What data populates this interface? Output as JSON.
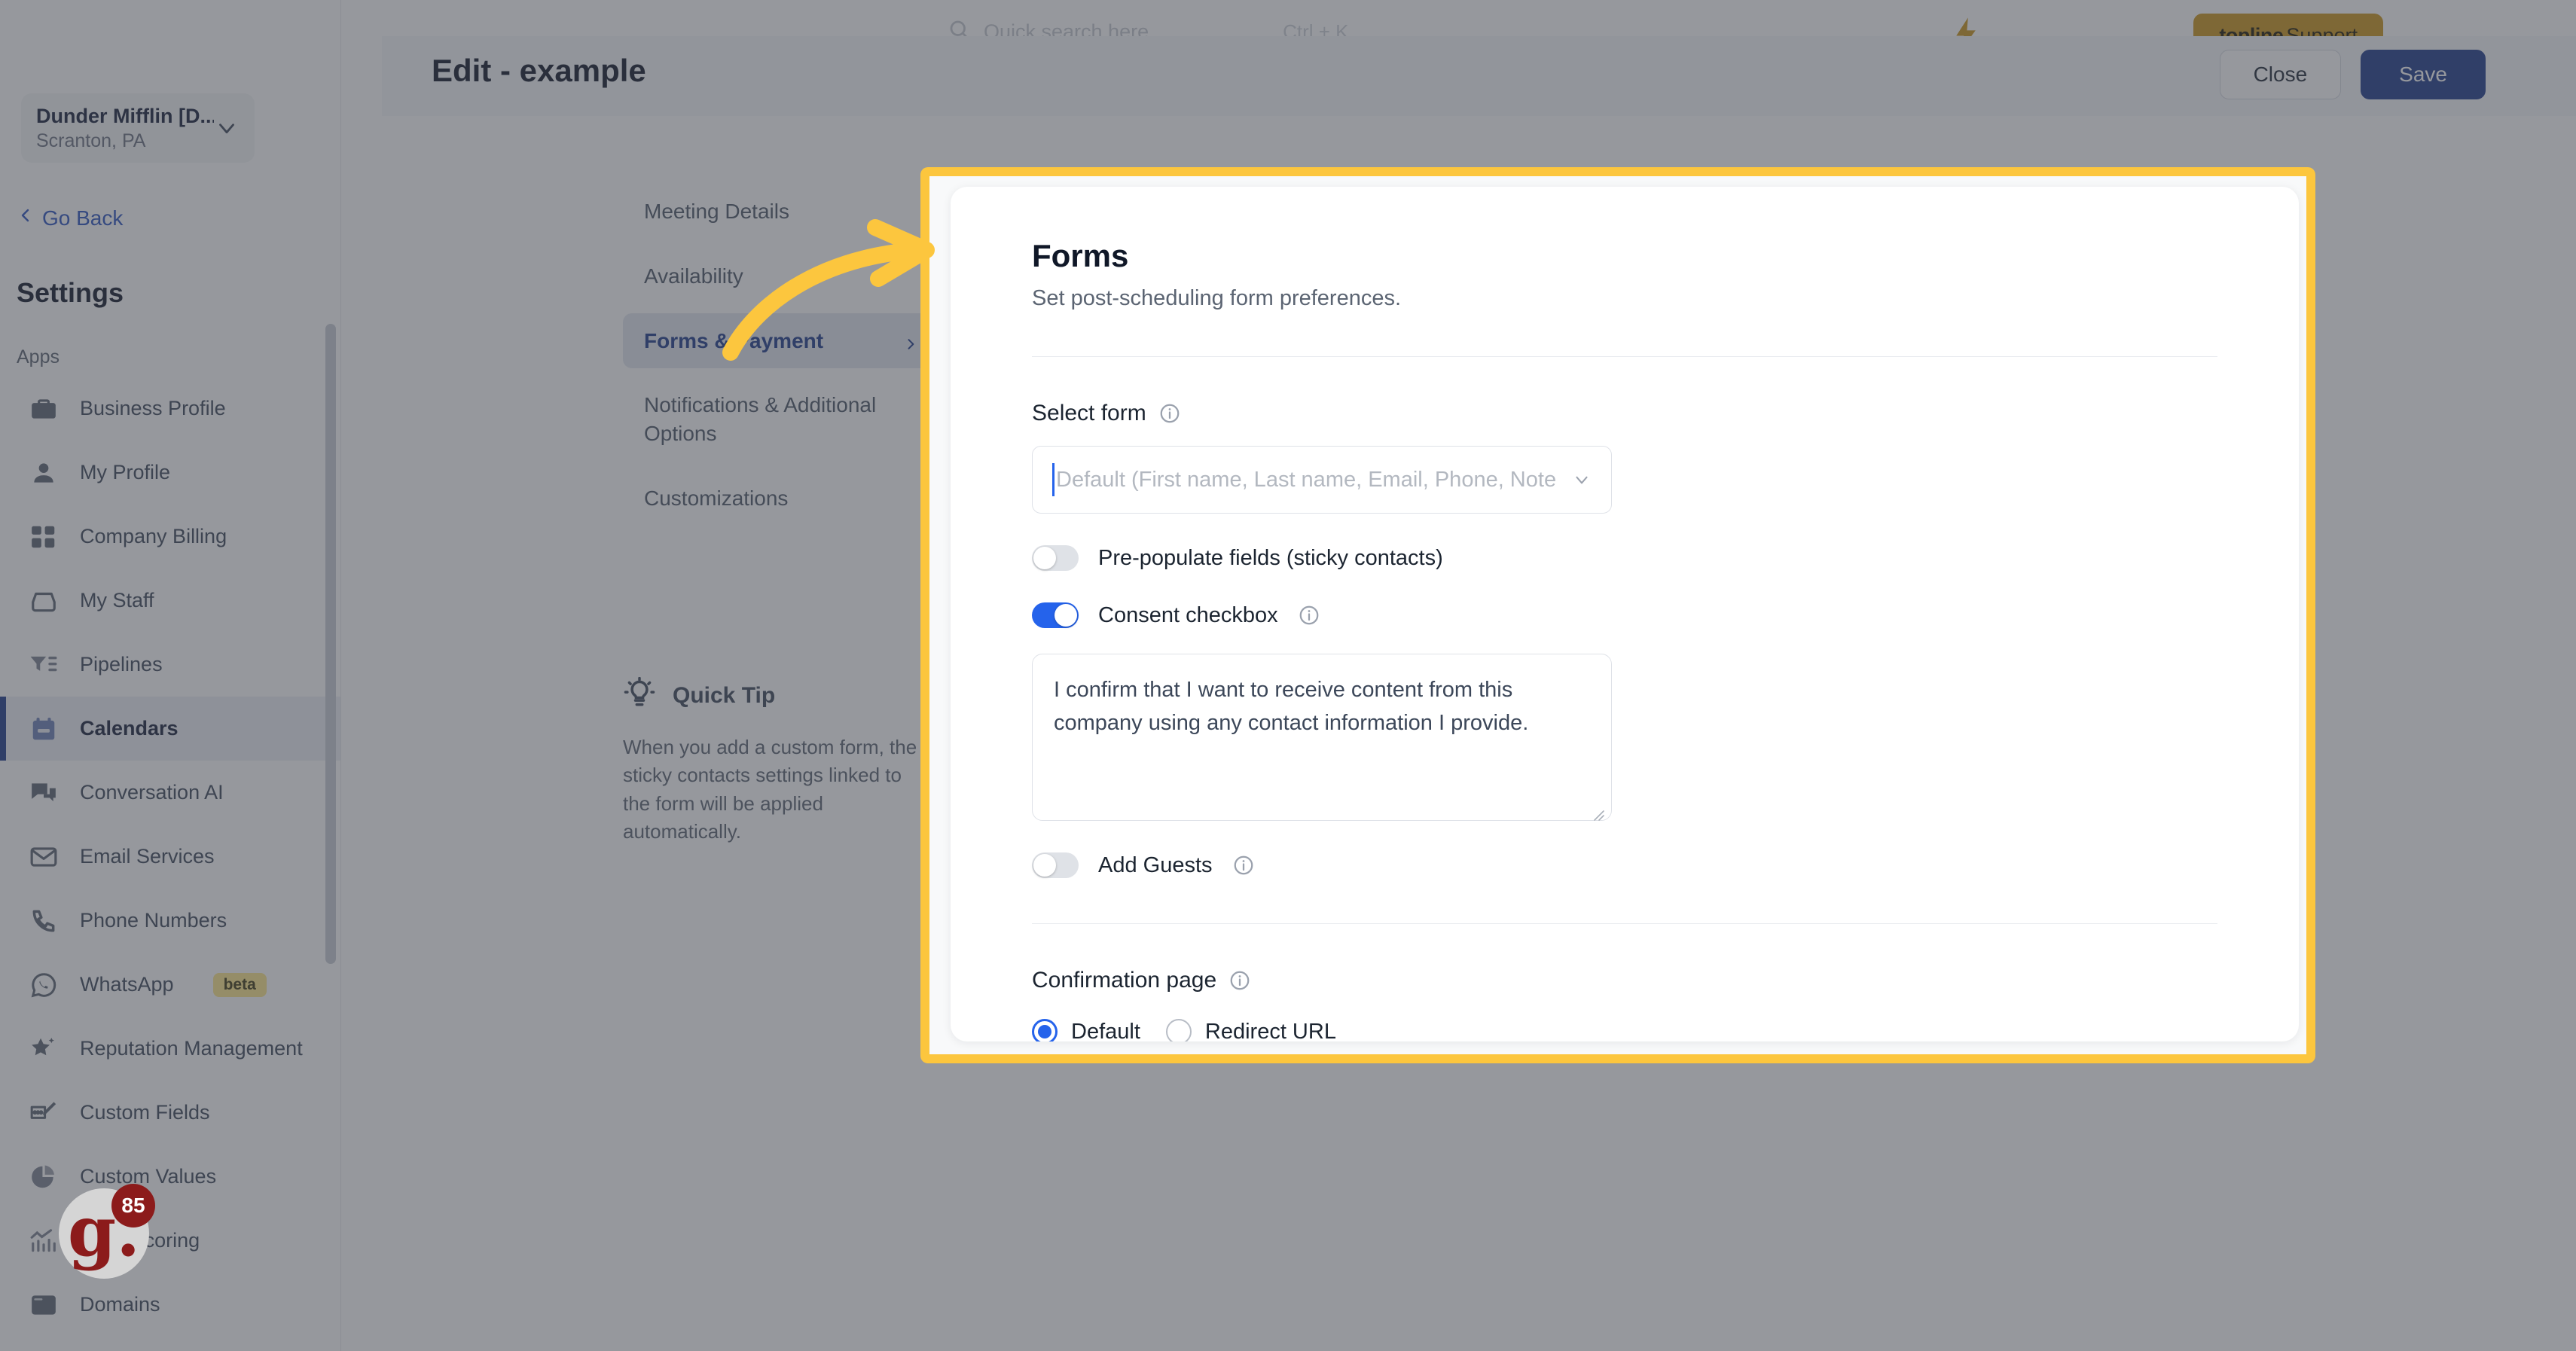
{
  "sidebar": {
    "location": {
      "name": "Dunder Mifflin [D...",
      "sub": "Scranton, PA"
    },
    "go_back": "Go Back",
    "settings_title": "Settings",
    "group_label": "Apps",
    "items": [
      {
        "label": "Business Profile",
        "icon": "briefcase-icon",
        "active": false
      },
      {
        "label": "My Profile",
        "icon": "person-icon",
        "active": false
      },
      {
        "label": "Company Billing",
        "icon": "calculator-icon",
        "active": false
      },
      {
        "label": "My Staff",
        "icon": "inbox-icon",
        "active": false
      },
      {
        "label": "Pipelines",
        "icon": "funnel-icon",
        "active": false
      },
      {
        "label": "Calendars",
        "icon": "calendar-icon",
        "active": true
      },
      {
        "label": "Conversation AI",
        "icon": "chat-bubbles-icon",
        "active": false
      },
      {
        "label": "Email Services",
        "icon": "envelope-icon",
        "active": false
      },
      {
        "label": "Phone Numbers",
        "icon": "phone-icon",
        "active": false
      },
      {
        "label": "WhatsApp",
        "icon": "whatsapp-icon",
        "active": false,
        "badge": "beta"
      },
      {
        "label": "Reputation Management",
        "icon": "star-icon",
        "active": false
      },
      {
        "label": "Custom Fields",
        "icon": "edit-field-icon",
        "active": false
      },
      {
        "label": "Custom Values",
        "icon": "pie-chart-icon",
        "active": false
      },
      {
        "label": "Lead Scoring",
        "icon": "chart-bars-icon",
        "active": false
      },
      {
        "label": "Domains",
        "icon": "browser-window-icon",
        "active": false
      }
    ]
  },
  "topbar": {
    "search_placeholder": "Quick search here",
    "search_icon": "search-icon",
    "shortcut_hint": "Ctrl + K",
    "bolt_icon": "lightning-bolt-icon",
    "support_brand": "topline",
    "support_label": " Support"
  },
  "page_header": {
    "title": "Edit - example",
    "close_label": "Close",
    "save_label": "Save"
  },
  "wizard": {
    "items": [
      {
        "label": "Meeting Details",
        "active": false
      },
      {
        "label": "Availability",
        "active": false
      },
      {
        "label": "Forms & Payment",
        "active": true
      },
      {
        "label": "Notifications & Additional Options",
        "active": false
      },
      {
        "label": "Customizations",
        "active": false
      }
    ]
  },
  "quick_tip": {
    "icon": "lightbulb-icon",
    "title": "Quick Tip",
    "body": "When you add a custom form, the sticky contacts settings linked to the form will be applied automatically."
  },
  "modal": {
    "title": "Forms",
    "subtitle": "Set post-scheduling form preferences.",
    "select_form": {
      "label": "Select form",
      "info_icon": "info-icon",
      "placeholder": "Default (First name, Last name, Email, Phone, Note",
      "chevron_icon": "chevron-down-icon"
    },
    "prepopulate": {
      "label": "Pre-populate fields (sticky contacts)",
      "on": false
    },
    "consent": {
      "label": "Consent checkbox",
      "info_icon": "info-icon",
      "on": true,
      "text": "I confirm that I want to receive content from this company using any contact information I provide."
    },
    "add_guests": {
      "label": "Add Guests",
      "info_icon": "info-icon",
      "on": false
    },
    "confirmation_page": {
      "label": "Confirmation page",
      "info_icon": "info-icon",
      "options": [
        {
          "label": "Default",
          "selected": true
        },
        {
          "label": "Redirect URL",
          "selected": false
        }
      ]
    }
  },
  "annotation": {
    "arrow_icon": "curved-arrow-icon",
    "highlight_color": "#fcc63e"
  },
  "widget": {
    "glyph": "g.",
    "count": "85"
  },
  "colors": {
    "accent_blue": "#2563eb",
    "nav_active": "#1e3a8a",
    "highlight_yellow": "#fcc63e",
    "support_gold": "#c9961c",
    "badge_red": "#8c1b1b"
  }
}
